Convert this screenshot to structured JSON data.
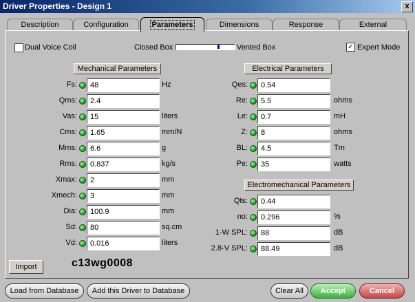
{
  "window": {
    "title": "Driver Properties - Design 1",
    "close": "x"
  },
  "tabs": [
    "Description",
    "Configuration",
    "Parameters",
    "Dimensions",
    "Response",
    "External"
  ],
  "active_tab": "Parameters",
  "options": {
    "dual_voice_coil": {
      "label": "Dual Voice Coil",
      "checked": false
    },
    "closed_box": "Closed Box",
    "vented_box": "Vented Box",
    "expert_mode": {
      "label": "Expert Mode",
      "checked": true,
      "mark": "✓"
    }
  },
  "mechanical": {
    "title": "Mechanical Parameters",
    "rows": [
      {
        "label": "Fs:",
        "value": "48",
        "unit": "Hz"
      },
      {
        "label": "Qms:",
        "value": "2.4",
        "unit": ""
      },
      {
        "label": "Vas:",
        "value": "15",
        "unit": "liters"
      },
      {
        "label": "Cms:",
        "value": "1.65",
        "unit": "mm/N"
      },
      {
        "label": "Mms:",
        "value": "6.6",
        "unit": "g"
      },
      {
        "label": "Rms:",
        "value": "0.837",
        "unit": "kg/s"
      },
      {
        "label": "Xmax:",
        "value": "2",
        "unit": "mm"
      },
      {
        "label": "Xmech:",
        "value": "3",
        "unit": "mm"
      },
      {
        "label": "Dia:",
        "value": "100.9",
        "unit": "mm"
      },
      {
        "label": "Sd:",
        "value": "80",
        "unit": "sq.cm"
      },
      {
        "label": "Vd:",
        "value": "0.016",
        "unit": "liters"
      }
    ]
  },
  "electrical": {
    "title": "Electrical Parameters",
    "rows": [
      {
        "label": "Qes:",
        "value": "0.54",
        "unit": ""
      },
      {
        "label": "Re:",
        "value": "5.5",
        "unit": "ohms"
      },
      {
        "label": "Le:",
        "value": "0.7",
        "unit": "mH"
      },
      {
        "label": "Z:",
        "value": "8",
        "unit": "ohms"
      },
      {
        "label": "BL:",
        "value": "4.5",
        "unit": "Tm"
      },
      {
        "label": "Pe:",
        "value": "35",
        "unit": "watts"
      }
    ]
  },
  "electromechanical": {
    "title": "Electromechanical Parameters",
    "rows": [
      {
        "label": "Qts:",
        "value": "0.44",
        "unit": ""
      },
      {
        "label": "no:",
        "value": "0.296",
        "unit": "%"
      },
      {
        "label": "1-W SPL:",
        "value": "88",
        "unit": "dB"
      },
      {
        "label": "2.8-V SPL:",
        "value": "88.49",
        "unit": "dB"
      }
    ]
  },
  "import_button": "Import",
  "model_name": "c13wg0008",
  "bottom": {
    "load": "Load from Database",
    "add": "Add this Driver to Database",
    "clear": "Clear All",
    "accept": "Accept",
    "cancel": "Cancel"
  }
}
